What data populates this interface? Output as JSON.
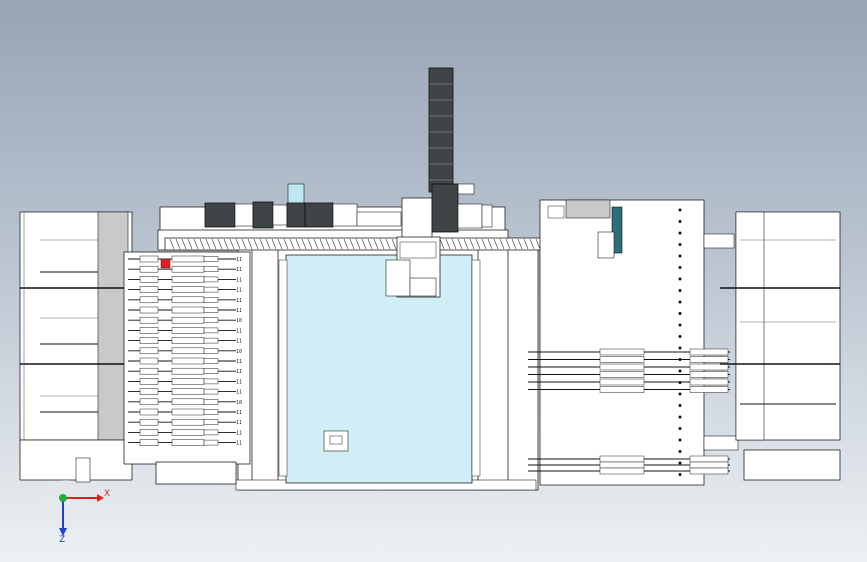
{
  "view": {
    "background_top": "#98a4b6",
    "background_bottom": "#eef1f4",
    "line_color": "#222222",
    "part_fill": "#ffffff",
    "dark_part_fill": "#3f4446",
    "gray_part_fill": "#c9c9c9",
    "base_panel_fill": "#cfeef5",
    "highlight_red": "#e02020"
  },
  "feeder_bank_left": {
    "slot_count": 19,
    "slot_labels": [
      "11",
      "11",
      "11",
      "11",
      "11",
      "11",
      "10",
      "11",
      "11",
      "10",
      "11",
      "11",
      "11",
      "11",
      "10",
      "11",
      "11",
      "11",
      "11"
    ]
  },
  "feeder_bank_right": {
    "upper_count": 6,
    "lower_count": 3
  },
  "axis_triad": {
    "x_label": "X",
    "z_label": "Z",
    "x_color": "#e02020",
    "y_color": "#20b040",
    "z_color": "#2040d0"
  }
}
